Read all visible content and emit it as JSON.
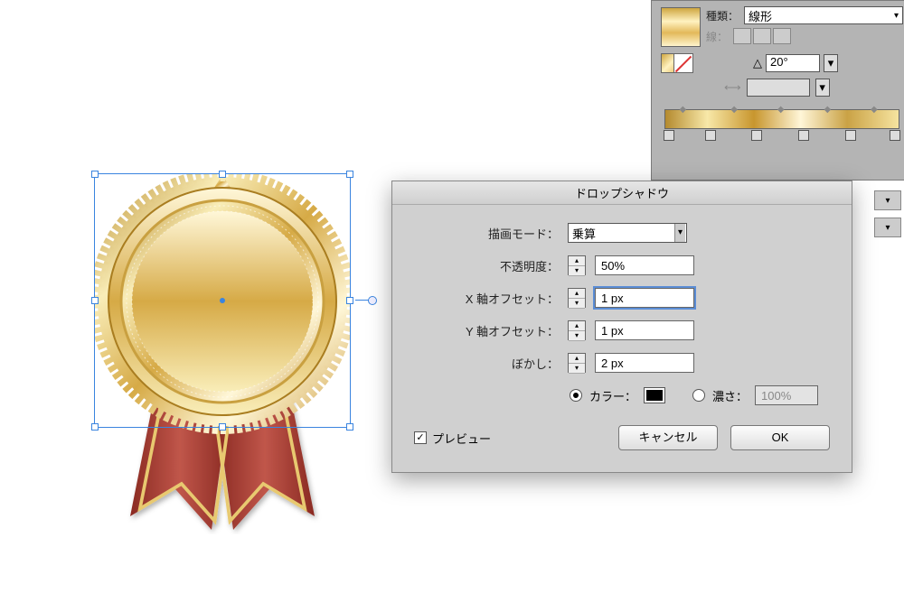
{
  "gradientPanel": {
    "typeLabel": "種類：",
    "typeValue": "線形",
    "strokeLabel": "線：",
    "angleSymbol": "△",
    "angleValue": "20°",
    "stops": [
      0,
      18,
      38,
      58,
      78,
      100
    ]
  },
  "dialog": {
    "title": "ドロップシャドウ",
    "blendModeLabel": "描画モード：",
    "blendModeValue": "乗算",
    "opacityLabel": "不透明度：",
    "opacityValue": "50%",
    "xOffsetLabel": "X 軸オフセット：",
    "xOffsetValue": "1 px",
    "yOffsetLabel": "Y 軸オフセット：",
    "yOffsetValue": "1 px",
    "blurLabel": "ぼかし：",
    "blurValue": "2 px",
    "colorLabel": "カラー：",
    "darknessLabel": "濃さ：",
    "darknessValue": "100%",
    "previewLabel": "プレビュー",
    "cancelLabel": "キャンセル",
    "okLabel": "OK"
  }
}
